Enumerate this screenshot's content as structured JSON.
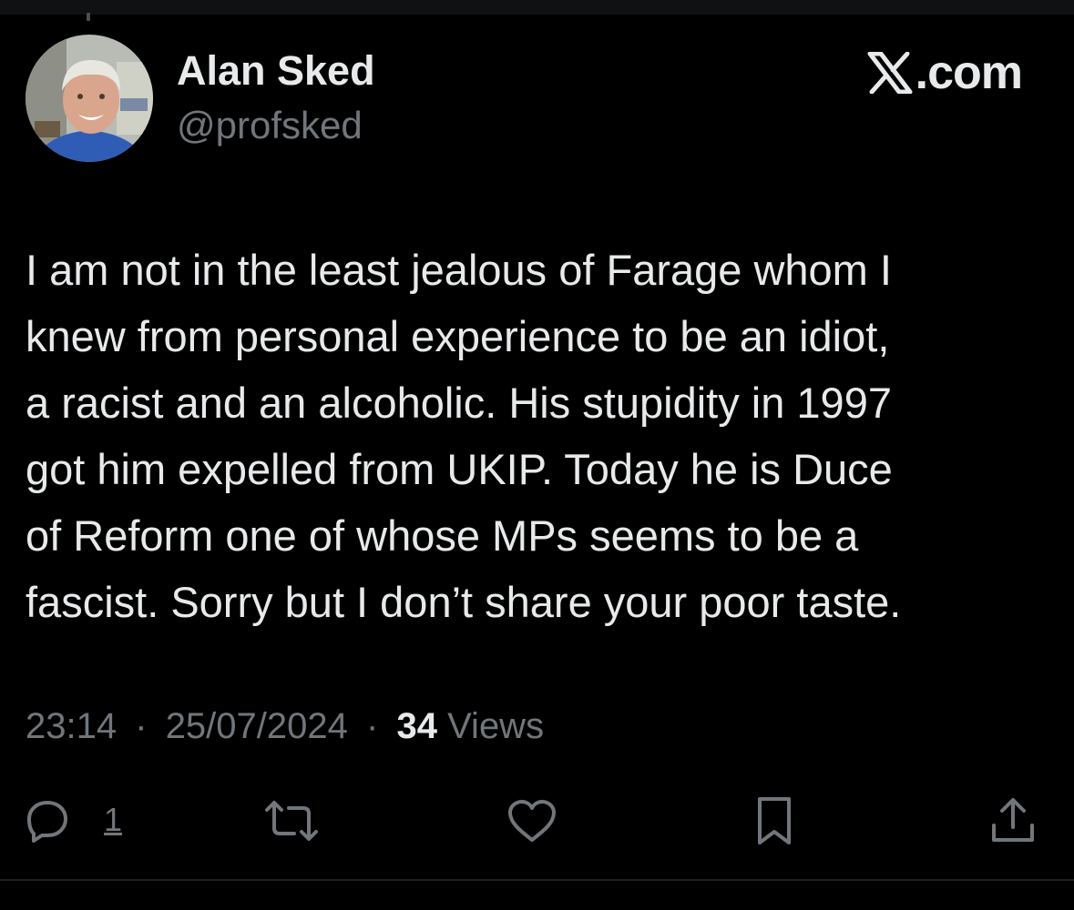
{
  "author": {
    "display_name": "Alan Sked",
    "handle": "@profsked"
  },
  "brand": {
    "label": ".com",
    "icon": "x-logo-icon"
  },
  "tweet": {
    "text": "I am not in the least jealous of Farage whom I\nknew from personal experience to be an idiot,\na racist and an alcoholic. His stupidity in 1997\ngot him expelled from UKIP. Today he is Duce\nof Reform one of whose MPs seems to be a\nfascist. Sorry but I don’t share your poor taste."
  },
  "meta": {
    "time": "23:14",
    "date": "25/07/2024",
    "views_count": "34",
    "views_label": "Views",
    "separator": "·"
  },
  "actions": {
    "reply_count": "1",
    "icons": [
      "reply-icon",
      "repost-icon",
      "like-icon",
      "bookmark-icon",
      "share-icon"
    ]
  },
  "colors": {
    "background": "#000000",
    "primary_text": "#e7e9ea",
    "secondary_text": "#71767b"
  }
}
